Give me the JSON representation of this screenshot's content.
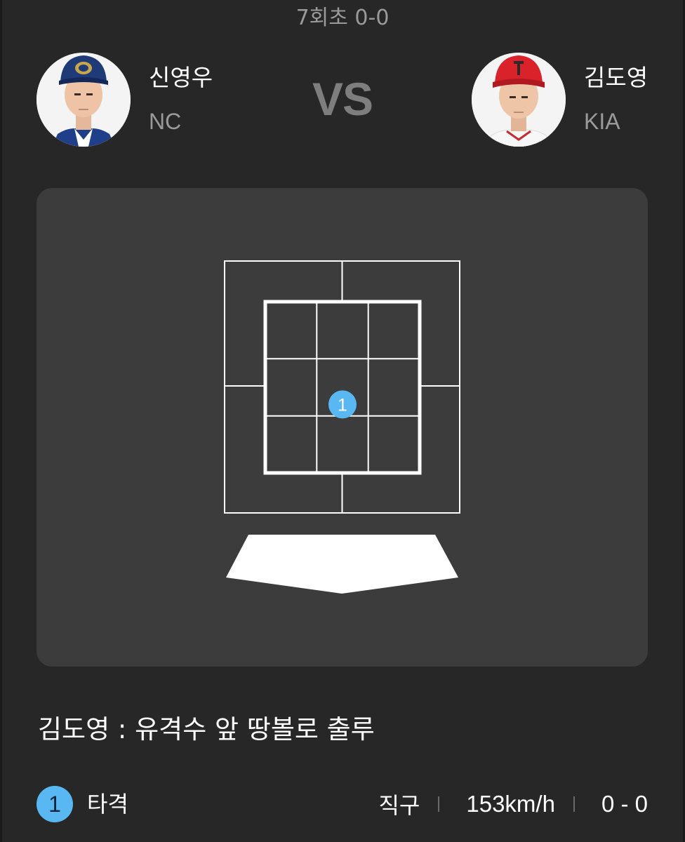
{
  "inning": "7회초 0-0",
  "vs_label": "VS",
  "pitcher": {
    "name": "신영우",
    "team": "NC",
    "cap_color": "#1e3b78"
  },
  "batter": {
    "name": "김도영",
    "team": "KIA",
    "cap_color": "#d9222a"
  },
  "strike_zone": {
    "pitches": [
      {
        "number": "1",
        "zone_x": 0.5,
        "zone_y": 0.6,
        "color": "#59b8f2"
      }
    ]
  },
  "result_text": "김도영 : 유격수 앞 땅볼로 출루",
  "pitch_summary": {
    "badge": "1",
    "label": "타격",
    "pitch_type": "직구",
    "speed": "153km/h",
    "count": "0 - 0"
  }
}
